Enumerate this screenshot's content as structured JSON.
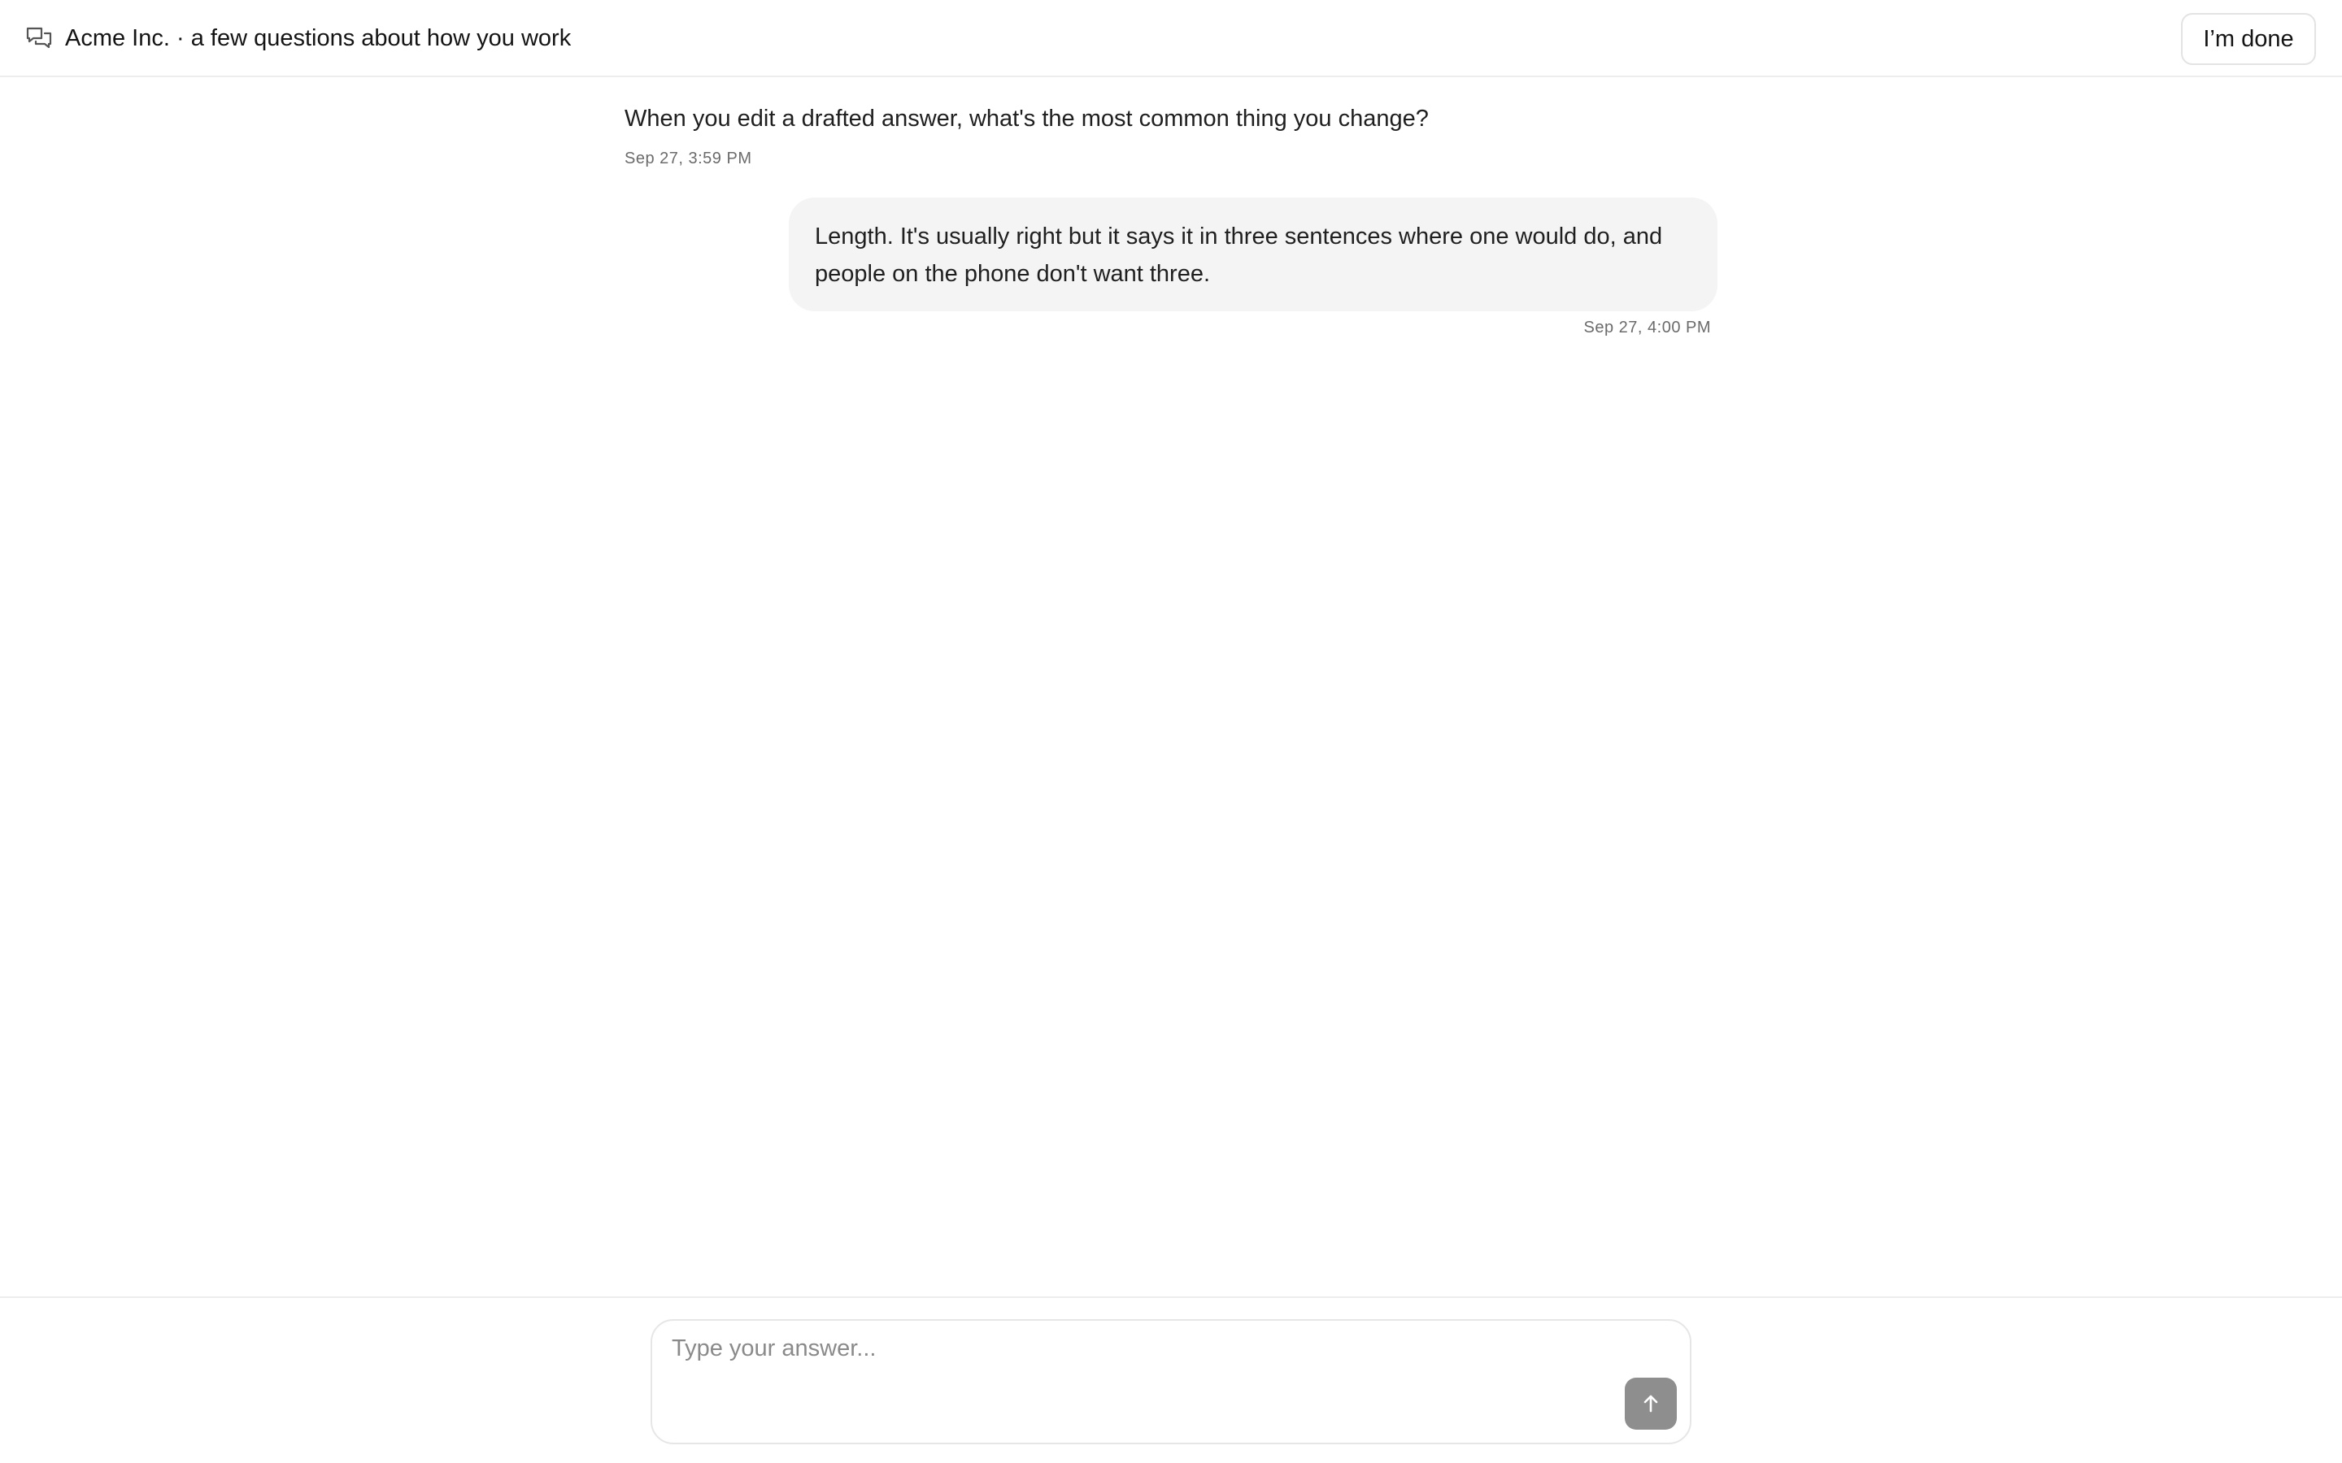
{
  "header": {
    "icon": "chat-bubbles-icon",
    "title": "Acme Inc. · a few questions about how you work",
    "done_label": "I’m done"
  },
  "conversation": {
    "question": {
      "text": "When you edit a drafted answer, what's the most common thing you change?",
      "time": "Sep 27, 3:59 PM"
    },
    "answer": {
      "text": "Length. It's usually right but it says it in three sentences where one would do, and people on the phone don't want three.",
      "time": "Sep 27, 4:00 PM"
    }
  },
  "composer": {
    "placeholder": "Type your answer...",
    "value": "",
    "send_icon": "arrow-up-icon"
  },
  "colors": {
    "bubble": "#f4f4f4",
    "send_button": "#8e8e8e",
    "border": "#ededed"
  }
}
